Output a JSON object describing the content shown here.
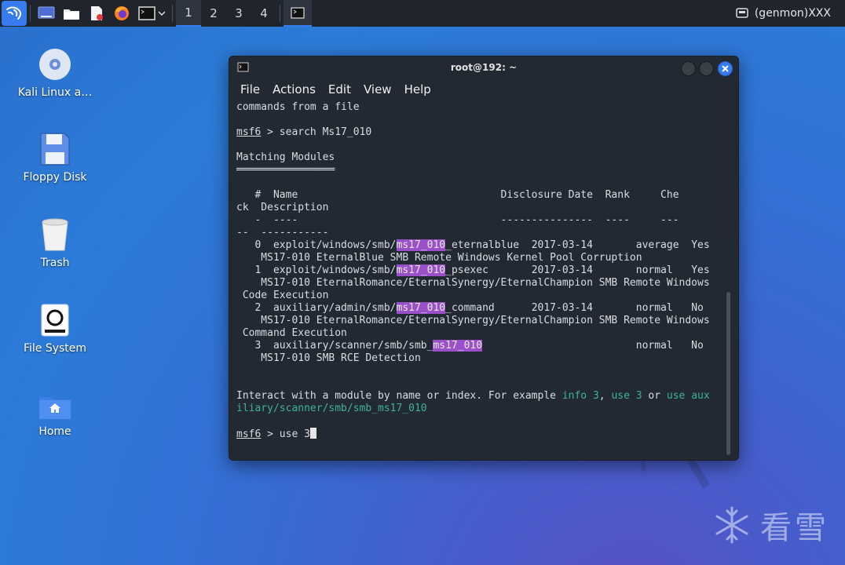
{
  "panel": {
    "workspaces": [
      "1",
      "2",
      "3",
      "4"
    ],
    "active_workspace": "1",
    "genmon": "(genmon)XXX"
  },
  "desktop": {
    "icons": [
      {
        "label": "Kali Linux a…"
      },
      {
        "label": "Floppy Disk"
      },
      {
        "label": "Trash"
      },
      {
        "label": "File System"
      },
      {
        "label": "Home"
      }
    ]
  },
  "terminal": {
    "title": "root@192: ~",
    "menu": [
      "File",
      "Actions",
      "Edit",
      "View",
      "Help"
    ],
    "prompt": "msf6",
    "lines": {
      "l0": "commands from a file",
      "l2_rest": " > search Ms17_010",
      "l4": "Matching Modules",
      "l5": "════════════════",
      "l7": "   #  Name                                 Disclosure Date  Rank     Che",
      "l8": "ck  Description",
      "l9": "   -  ----                                 ---------------  ----     ---",
      "l10": "--  -----------",
      "r0_pre": "   0  exploit/windows/smb/",
      "r0_hl": "ms17_010",
      "r0_post": "_eternalblue  2017-03-14       average  Yes",
      "r0_desc": "    MS17-010 EternalBlue SMB Remote Windows Kernel Pool Corruption",
      "r1_pre": "   1  exploit/windows/smb/",
      "r1_hl": "ms17_010",
      "r1_post": "_psexec       2017-03-14       normal   Yes",
      "r1_desc": "    MS17-010 EternalRomance/EternalSynergy/EternalChampion SMB Remote Windows",
      "r1_desc2": " Code Execution",
      "r2_pre": "   2  auxiliary/admin/smb/",
      "r2_hl": "ms17_010",
      "r2_post": "_command      2017-03-14       normal   No",
      "r2_desc": "    MS17-010 EternalRomance/EternalSynergy/EternalChampion SMB Remote Windows",
      "r2_desc2": " Command Execution",
      "r3_pre": "   3  auxiliary/scanner/smb/smb_",
      "r3_hl": "ms17_010",
      "r3_post": "                         normal   No",
      "r3_desc": "    MS17-010 SMB RCE Detection",
      "i1_a": "Interact with a module by name or index. For example ",
      "i1_b": "info 3",
      "i1_c": ", ",
      "i1_d": "use 3",
      "i1_e": " or ",
      "i1_f": "use aux",
      "i2": "iliary/scanner/smb/smb_ms17_010",
      "last_rest": " > use 3"
    }
  },
  "watermark": "看雪",
  "colors": {
    "kali_blue": "#367bf0",
    "terminal_bg": "#232933",
    "highlight": "#9b4fc8",
    "link_cyan": "#3fb0a0"
  }
}
